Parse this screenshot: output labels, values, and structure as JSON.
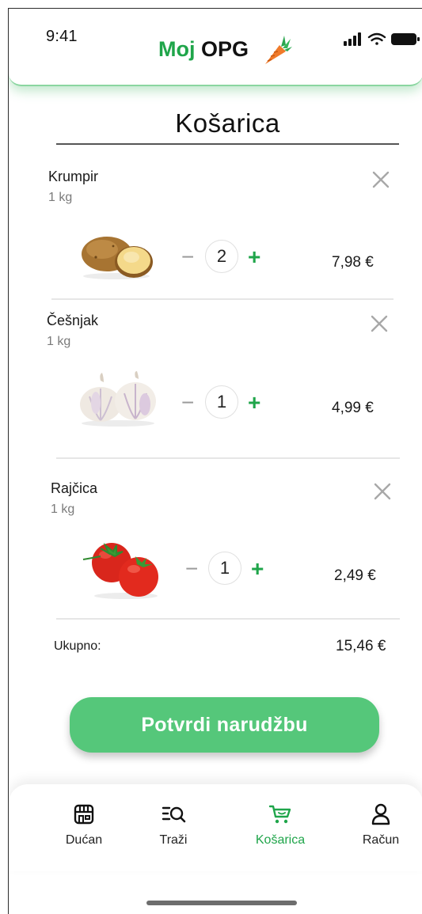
{
  "status_bar": {
    "time": "9:41",
    "icons": [
      "signal-icon",
      "wifi-icon",
      "battery-icon"
    ]
  },
  "header": {
    "logo_moj": "Moj",
    "logo_opg": "OPG",
    "logo_icon": "carrot-icon"
  },
  "page": {
    "title": "Košarica"
  },
  "cart": {
    "items": [
      {
        "name": "Krumpir",
        "unit": "1 kg",
        "quantity": "2",
        "price": "7,98 €",
        "image": "potato"
      },
      {
        "name": "Češnjak",
        "unit": "1 kg",
        "quantity": "1",
        "price": "4,99 €",
        "image": "garlic"
      },
      {
        "name": "Rajčica",
        "unit": "1 kg",
        "quantity": "1",
        "price": "2,49 €",
        "image": "tomato"
      }
    ],
    "minus_symbol": "−",
    "plus_symbol": "+",
    "total_label": "Ukupno:",
    "total_value": "15,46 €"
  },
  "actions": {
    "confirm_label": "Potvrdi narudžbu"
  },
  "nav": {
    "items": [
      {
        "label": "Dućan",
        "icon": "store-icon",
        "active": false
      },
      {
        "label": "Traži",
        "icon": "search-list-icon",
        "active": false
      },
      {
        "label": "Košarica",
        "icon": "cart-icon",
        "active": true
      },
      {
        "label": "Račun",
        "icon": "user-icon",
        "active": false
      }
    ]
  },
  "colors": {
    "accent": "#1fa54a",
    "button": "#55c77a",
    "shadow_green": "#8ad6a0"
  }
}
